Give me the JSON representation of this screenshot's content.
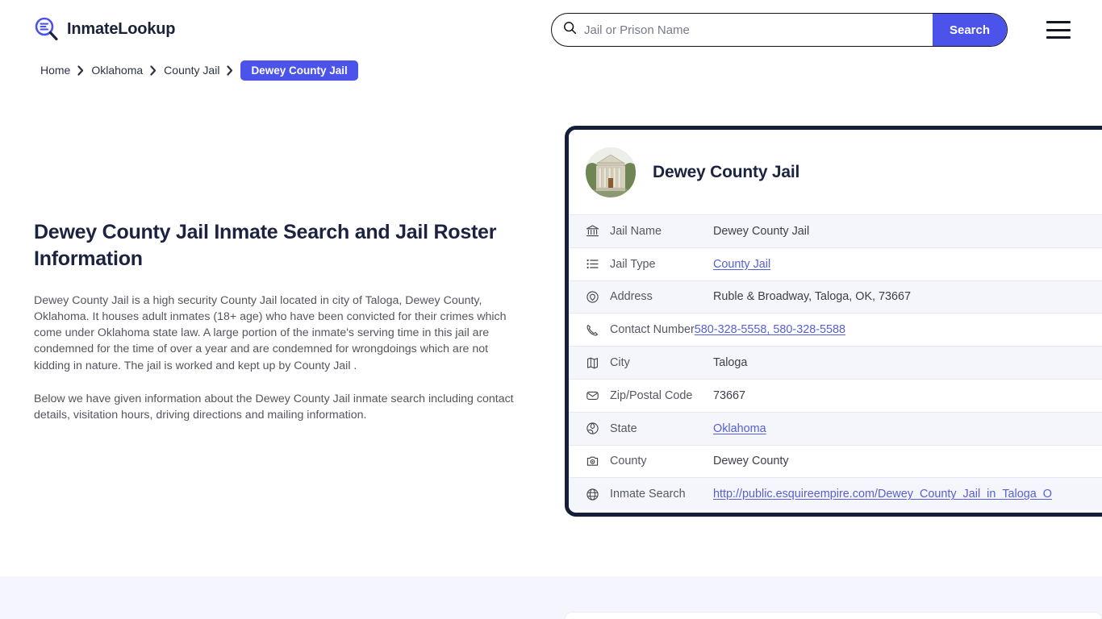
{
  "header": {
    "logo_icon": "magnifier-list-icon",
    "logo_text": "InmateLookup",
    "search": {
      "icon": "search-icon",
      "placeholder": "Jail or Prison Name",
      "value": "",
      "button_label": "Search"
    },
    "menu_icon": "hamburger-menu-icon"
  },
  "breadcrumb": {
    "items": [
      {
        "label": "Home",
        "current": false
      },
      {
        "label": "Oklahoma",
        "current": false
      },
      {
        "label": "County Jail",
        "current": false
      },
      {
        "label": "Dewey County Jail",
        "current": true
      }
    ],
    "separator_icon": "chevron-right-icon"
  },
  "main": {
    "title": "Dewey County Jail Inmate Search and Jail Roster Information",
    "paragraph_1": "Dewey County Jail is a high security County Jail located in city of Taloga, Dewey County, Oklahoma. It houses adult inmates (18+ age) who have been convicted for their crimes which come under Oklahoma state law. A large portion of the inmate's serving time in this jail are condemned for the time of over a year and are condemned for wrongdoings which are not kidding in nature. The jail is worked and kept up by County Jail .",
    "paragraph_2": "Below we have given information about the Dewey County Jail inmate search including contact details, visitation hours, driving directions and mailing information."
  },
  "info_card": {
    "avatar_icon": "courthouse-photo",
    "title": "Dewey County Jail",
    "rows": [
      {
        "icon": "bank-icon",
        "label": "Jail Name",
        "value": "Dewey County Jail",
        "link": false
      },
      {
        "icon": "list-icon",
        "label": "Jail Type",
        "value": "County Jail",
        "link": true
      },
      {
        "icon": "location-icon",
        "label": "Address",
        "value": "Ruble & Broadway, Taloga, OK, 73667",
        "link": false
      },
      {
        "icon": "phone-icon",
        "label": "Contact Number",
        "value": "580-328-5558, 580-328-5588",
        "link": true
      },
      {
        "icon": "map-icon",
        "label": "City",
        "value": "Taloga",
        "link": false
      },
      {
        "icon": "envelope-icon",
        "label": "Zip/Postal Code",
        "value": "73667",
        "link": false
      },
      {
        "icon": "globe-pin-icon",
        "label": "State",
        "value": "Oklahoma",
        "link": true
      },
      {
        "icon": "county-icon",
        "label": "County",
        "value": "Dewey County",
        "link": false
      },
      {
        "icon": "web-icon",
        "label": "Inmate Search",
        "value": "http://public.esquireempire.com/Dewey_County_Jail_in_Taloga_O",
        "link": true
      }
    ]
  },
  "colors": {
    "accent": "#4c53ea",
    "link": "#5560d6",
    "card_border": "#161f3a",
    "row_alt": "#f5f5fc",
    "band": "#f5f5fd",
    "heading": "#1b2340"
  }
}
